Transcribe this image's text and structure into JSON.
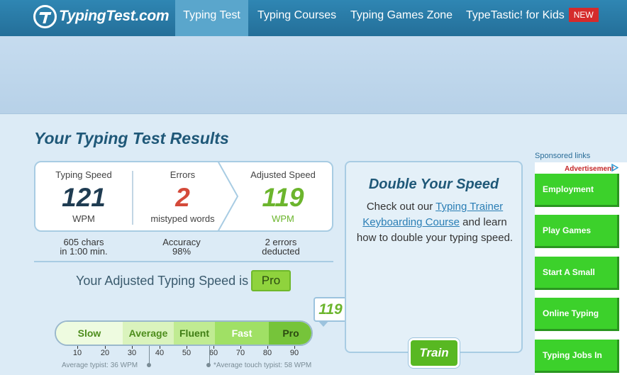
{
  "nav": {
    "logo_text": "TypingTest.com",
    "items": [
      {
        "label": "Typing Test",
        "active": true
      },
      {
        "label": "Typing Courses"
      },
      {
        "label": "Typing Games Zone"
      },
      {
        "label": "TypeTastic! for Kids"
      }
    ],
    "new_badge": "NEW"
  },
  "results": {
    "title": "Your Typing Test Results",
    "speed": {
      "label": "Typing Speed",
      "value": "121",
      "unit": "WPM"
    },
    "errors": {
      "label": "Errors",
      "value": "2",
      "unit": "mistyped words"
    },
    "adjusted": {
      "label": "Adjusted Speed",
      "value": "119",
      "unit": "WPM"
    },
    "chars_line1": "605 chars",
    "chars_line2": "in 1:00 min.",
    "accuracy_line1": "Accuracy",
    "accuracy_line2": "98%",
    "errors_line1": "2 errors",
    "errors_line2": "deducted",
    "adjusted_text": "Your Adjusted Typing Speed is",
    "level": "Pro"
  },
  "scale": {
    "current_wpm": "119",
    "segments": [
      "Slow",
      "Average",
      "Fluent",
      "Fast",
      "Pro"
    ],
    "ticks": [
      "10",
      "20",
      "30",
      "40",
      "50",
      "60",
      "70",
      "80",
      "90"
    ],
    "average_typist": "Average typist: 36 WPM",
    "average_touch_typist": "*Average touch typist: 58 WPM"
  },
  "double_speed": {
    "title": "Double Your Speed",
    "text_before": "Check out our ",
    "link": "Typing Trainer Keyboarding Course",
    "text_after": " and learn how to double your typing speed.",
    "button": "Train"
  },
  "sponsored": {
    "label": "Sponsored links",
    "ad_label": "Advertisement",
    "links": [
      "Employment",
      "Play Games",
      "Start A Small",
      "Online Typing",
      "Typing Jobs In"
    ]
  },
  "colors": {
    "nav": "#2a7aa6",
    "accent_green": "#6cb52d",
    "error_red": "#d44a3a",
    "title_blue": "#1f5878"
  }
}
